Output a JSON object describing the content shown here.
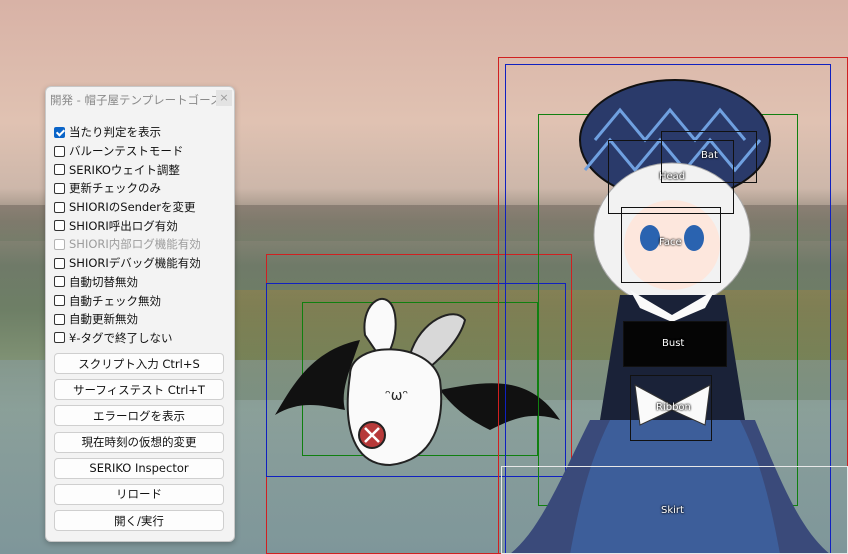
{
  "panel": {
    "title": "開発 - 帽子屋テンプレートゴースト",
    "close_glyph": "×",
    "checkboxes": [
      {
        "label": "当たり判定を表示",
        "checked": true,
        "disabled": false
      },
      {
        "label": "バルーンテストモード",
        "checked": false,
        "disabled": false
      },
      {
        "label": "SERIKOウェイト調整",
        "checked": false,
        "disabled": false
      },
      {
        "label": "更新チェックのみ",
        "checked": false,
        "disabled": false
      },
      {
        "label": "SHIORIのSenderを変更",
        "checked": false,
        "disabled": false
      },
      {
        "label": "SHIORI呼出ログ有効",
        "checked": false,
        "disabled": false
      },
      {
        "label": "SHIORI内部ログ機能有効",
        "checked": false,
        "disabled": true
      },
      {
        "label": "SHIORIデバッグ機能有効",
        "checked": false,
        "disabled": false
      },
      {
        "label": "自動切替無効",
        "checked": false,
        "disabled": false
      },
      {
        "label": "自動チェック無効",
        "checked": false,
        "disabled": false
      },
      {
        "label": "自動更新無効",
        "checked": false,
        "disabled": false
      },
      {
        "label": "¥-タグで終了しない",
        "checked": false,
        "disabled": false
      }
    ],
    "buttons": [
      "スクリプト入力 Ctrl+S",
      "サーフィステスト Ctrl+T",
      "エラーログを表示",
      "現在時刻の仮想的変更",
      "SERIKO Inspector",
      "リロード",
      "開く/実行"
    ]
  },
  "hit_regions": {
    "bat": "Bat",
    "head": "Head",
    "face": "Face",
    "bust": "Bust",
    "ribbon": "Ribbon",
    "skirt": "Skirt"
  }
}
